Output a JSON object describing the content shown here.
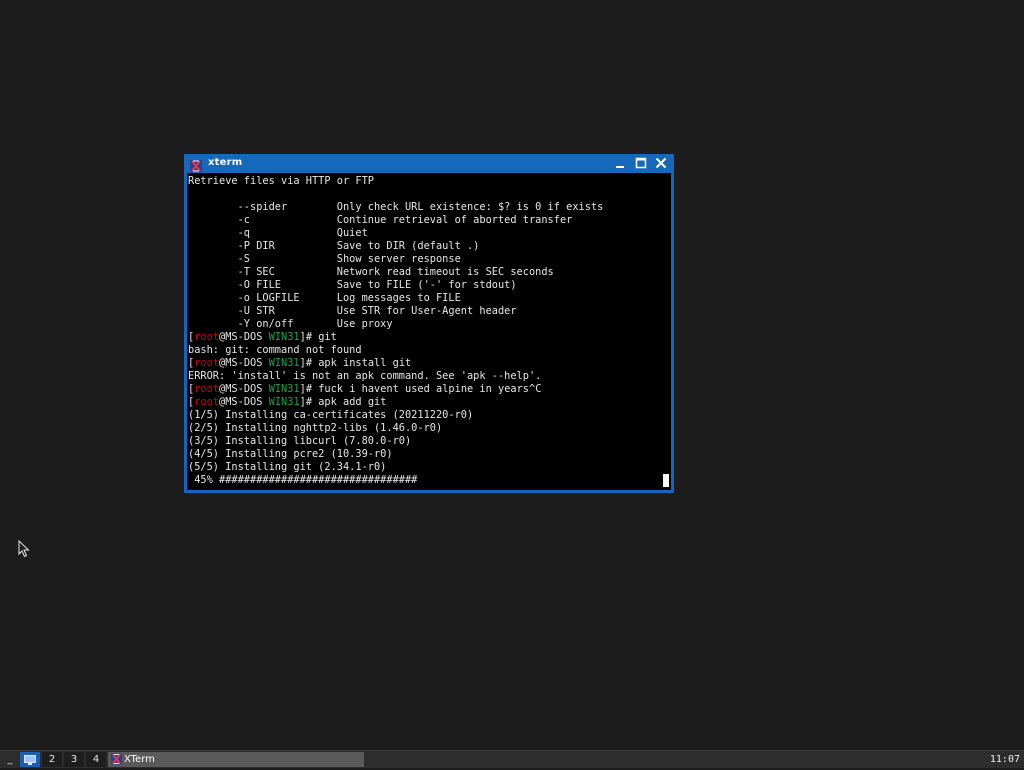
{
  "window": {
    "title": "xterm",
    "icon": "xterm-logo-icon",
    "controls": {
      "minimize": "minimize-icon",
      "maximize": "maximize-icon",
      "close": "close-icon"
    }
  },
  "terminal": {
    "lines": [
      "Retrieve files via HTTP or FTP",
      "",
      "        --spider        Only check URL existence: $? is 0 if exists",
      "        -c              Continue retrieval of aborted transfer",
      "        -q              Quiet",
      "        -P DIR          Save to DIR (default .)",
      "        -S              Show server response",
      "        -T SEC          Network read timeout is SEC seconds",
      "        -O FILE         Save to FILE ('-' for stdout)",
      "        -o LOGFILE      Log messages to FILE",
      "        -U STR          Use STR for User-Agent header",
      "        -Y on/off       Use proxy"
    ],
    "prompt": {
      "open": "[",
      "user": "root",
      "at_host": "@MS-DOS ",
      "dir": "WIN31",
      "close": "]# "
    },
    "session": [
      {
        "cmd": "git"
      },
      {
        "out": "bash: git: command not found"
      },
      {
        "cmd": "apk install git"
      },
      {
        "out": "ERROR: 'install' is not an apk command. See 'apk --help'."
      },
      {
        "cmd": "fuck i havent used alpine in years^C"
      },
      {
        "cmd": "apk add git"
      },
      {
        "out": "(1/5) Installing ca-certificates (20211220-r0)"
      },
      {
        "out": "(2/5) Installing nghttp2-libs (1.46.0-r0)"
      },
      {
        "out": "(3/5) Installing libcurl (7.80.0-r0)"
      },
      {
        "out": "(4/5) Installing pcre2 (10.39-r0)"
      },
      {
        "out": "(5/5) Installing git (2.34.1-r0)"
      },
      {
        "out": " 45% ################################"
      }
    ],
    "progress_percent": 45
  },
  "taskbar": {
    "menu_label": "_",
    "workspaces": [
      {
        "label": "",
        "icon": "desktop-icon",
        "active": true
      },
      {
        "label": "2",
        "active": false
      },
      {
        "label": "3",
        "active": false
      },
      {
        "label": "4",
        "active": false
      }
    ],
    "task": {
      "label": "XTerm",
      "icon": "xterm-logo-icon"
    },
    "clock": "11:07"
  },
  "colors": {
    "desktop": "#1c1c1c",
    "window_frame": "#1565c0",
    "prompt_user": "#cd0000",
    "prompt_dir": "#16a34a",
    "terminal_text": "#e6e6e6"
  }
}
